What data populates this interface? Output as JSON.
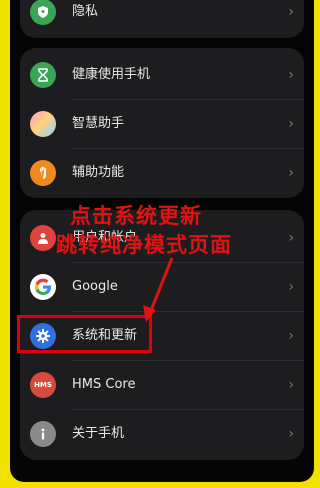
{
  "settings": {
    "privacy_label": "隐私",
    "items_group_2": [
      {
        "label": "健康使用手机",
        "icon": "hourglass-icon"
      },
      {
        "label": "智慧助手",
        "icon": "assistant-orb-icon"
      },
      {
        "label": "辅助功能",
        "icon": "hand-icon"
      }
    ],
    "items_group_3": [
      {
        "label": "用户和帐户",
        "icon": "user-icon"
      },
      {
        "label": "Google",
        "icon": "google-icon"
      },
      {
        "label": "系统和更新",
        "icon": "gear-icon"
      },
      {
        "label": "HMS Core",
        "icon": "hms-icon"
      },
      {
        "label": "关于手机",
        "icon": "info-icon"
      }
    ],
    "hms_icon_text": "HMS",
    "chevron": "›"
  },
  "annotation": {
    "line1": "点击系统更新",
    "line2": "跳转纯净模式页面",
    "color": "#e01212"
  },
  "colors": {
    "frame": "#f2e000",
    "card": "#1d1d1f",
    "privacy_icon": "#3aa655",
    "health_icon": "#3aa655",
    "assist_icon": "#f08a1e",
    "user_icon": "#e0433a",
    "system_icon": "#2f6fe0",
    "hms_icon": "#d84a3a",
    "info_icon": "#8a8a8a"
  }
}
